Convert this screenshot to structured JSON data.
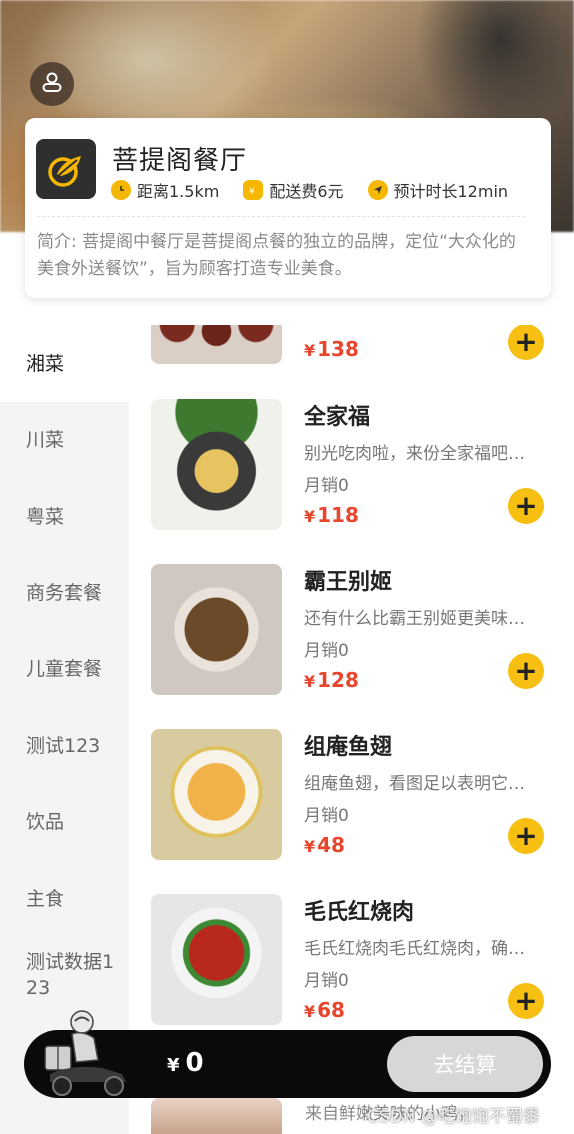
{
  "header": {
    "shop_name": "菩提阁餐厅",
    "distance": "距离1.5km",
    "delivery_fee": "配送费6元",
    "delivery_time": "预计时长12min",
    "intro": "简介: 菩提阁中餐厅是菩提阁点餐的独立的品牌，定位“大众化的美食外送餐饮”，旨为顾客打造专业美食。"
  },
  "sidebar": {
    "items": [
      {
        "label": "湘菜",
        "active": true
      },
      {
        "label": "川菜"
      },
      {
        "label": "粤菜"
      },
      {
        "label": "商务套餐"
      },
      {
        "label": "儿童套餐"
      },
      {
        "label": "测试123"
      },
      {
        "label": "饮品"
      },
      {
        "label": "主食"
      },
      {
        "label": "测试数据123"
      }
    ]
  },
  "foods": [
    {
      "name": "",
      "desc": "",
      "sales": "",
      "price": "138",
      "currency": "¥"
    },
    {
      "name": "全家福",
      "desc": "别光吃肉啦，来份全家福吧，让你长寿又美美哒",
      "sales": "月销0",
      "price": "118",
      "currency": "¥"
    },
    {
      "name": "霸王别姬",
      "desc": "还有什么比霸王别姬更美味的吗？",
      "sales": "月销0",
      "price": "128",
      "currency": "¥"
    },
    {
      "name": "组庵鱼翅",
      "desc": "组庵鱼翅，看图足以表明它的美味",
      "sales": "月销0",
      "price": "48",
      "currency": "¥"
    },
    {
      "name": "毛氏红烧肉",
      "desc": "毛氏红烧肉毛氏红烧肉，确定不来一份？",
      "sales": "月销0",
      "price": "68",
      "currency": "¥"
    }
  ],
  "cart": {
    "currency": "¥",
    "total": "0",
    "checkout_label": "去结算"
  },
  "peek_text": "来自鲜嫩美味的小鸡，",
  "watermark": "CSDN @吃饱饱不蜀黍",
  "colors": {
    "accent": "#f7bf12",
    "price": "#e8452c",
    "cart_bg": "#0a0a0a"
  }
}
